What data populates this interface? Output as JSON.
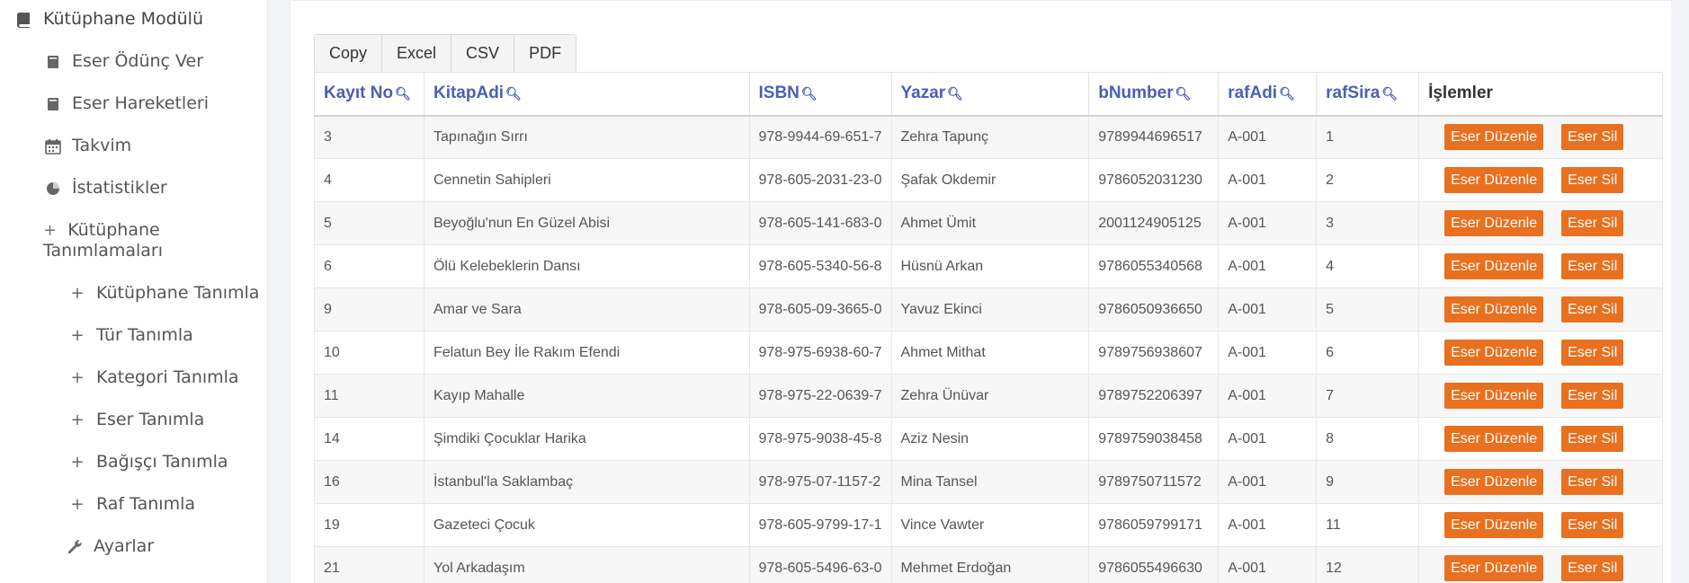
{
  "sidebar": {
    "module": "Kütüphane Modülü",
    "items": [
      {
        "label": "Eser Ödünç Ver",
        "icon": "book-icon"
      },
      {
        "label": "Eser Hareketleri",
        "icon": "book-icon"
      },
      {
        "label": "Takvim",
        "icon": "calendar-icon"
      },
      {
        "label": "İstatistikler",
        "icon": "pie-chart-icon"
      },
      {
        "label": "Kütüphane Tanımlamaları",
        "icon": "plus-icon"
      },
      {
        "label": "Kütüphane Tanımla",
        "icon": "plus-icon"
      },
      {
        "label": "Tür Tanımla",
        "icon": "plus-icon"
      },
      {
        "label": "Kategori Tanımla",
        "icon": "plus-icon"
      },
      {
        "label": "Eser Tanımla",
        "icon": "plus-icon"
      },
      {
        "label": "Bağışçı Tanımla",
        "icon": "plus-icon"
      },
      {
        "label": "Raf Tanımla",
        "icon": "plus-icon"
      },
      {
        "label": "Ayarlar",
        "icon": "wrench-icon"
      }
    ]
  },
  "export": {
    "copy": "Copy",
    "excel": "Excel",
    "csv": "CSV",
    "pdf": "PDF"
  },
  "table": {
    "headers": [
      "Kayıt No",
      "KitapAdi",
      "ISBN",
      "Yazar",
      "bNumber",
      "rafAdi",
      "rafSira",
      "İşlemler"
    ],
    "edit_label": "Eser Düzenle",
    "delete_label": "Eser Sil",
    "rows": [
      [
        "3",
        "Tapınağın Sırrı",
        "978-9944-69-651-7",
        "Zehra Tapunç",
        "9789944696517",
        "A-001",
        "1"
      ],
      [
        "4",
        "Cennetin Sahipleri",
        "978-605-2031-23-0",
        "Şafak Okdemir",
        "9786052031230",
        "A-001",
        "2"
      ],
      [
        "5",
        "Beyoğlu'nun En Güzel Abisi",
        "978-605-141-683-0",
        "Ahmet Ümit",
        "2001124905125",
        "A-001",
        "3"
      ],
      [
        "6",
        "Ölü Kelebeklerin Dansı",
        "978-605-5340-56-8",
        "Hüsnü Arkan",
        "9786055340568",
        "A-001",
        "4"
      ],
      [
        "9",
        "Amar ve Sara",
        "978-605-09-3665-0",
        "Yavuz Ekinci",
        "9786050936650",
        "A-001",
        "5"
      ],
      [
        "10",
        "Felatun Bey İle Rakım Efendi",
        "978-975-6938-60-7",
        "Ahmet Mithat",
        "9789756938607",
        "A-001",
        "6"
      ],
      [
        "11",
        "Kayıp Mahalle",
        "978-975-22-0639-7",
        "Zehra Ünüvar",
        "9789752206397",
        "A-001",
        "7"
      ],
      [
        "14",
        "Şimdiki Çocuklar Harika",
        "978-975-9038-45-8",
        "Aziz Nesin",
        "9789759038458",
        "A-001",
        "8"
      ],
      [
        "16",
        "İstanbul'la Saklambaç",
        "978-975-07-1157-2",
        "Mina Tansel",
        "9789750711572",
        "A-001",
        "9"
      ],
      [
        "19",
        "Gazeteci Çocuk",
        "978-605-9799-17-1",
        "Vince Vawter",
        "9786059799171",
        "A-001",
        "11"
      ],
      [
        "21",
        "Yol Arkadaşım",
        "978-605-5496-63-0",
        "Mehmet Erdoğan",
        "9786055496630",
        "A-001",
        "12"
      ]
    ]
  },
  "colors": {
    "header_text": "#4a5fb6",
    "action_button": "#e8701f"
  }
}
